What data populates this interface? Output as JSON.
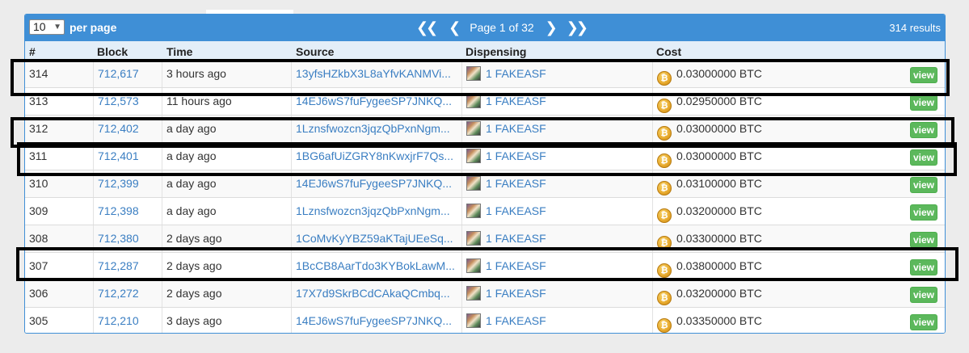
{
  "toolbar": {
    "per_page_value": "10",
    "per_page_label": "per page",
    "first_icon": "double-chevron-left",
    "prev_icon": "chevron-left",
    "page_label": "Page 1 of 32",
    "next_icon": "chevron-right",
    "last_icon": "double-chevron-right",
    "results": "314 results"
  },
  "columns": [
    "#",
    "Block",
    "Time",
    "Source",
    "Dispensing",
    "Cost"
  ],
  "view_label": "view",
  "colors": {
    "header_bar": "#3f8fd6",
    "link": "#3a7ec2",
    "view_button": "#5cb85c",
    "highlight_box": "#000000"
  },
  "rows": [
    {
      "num": "314",
      "block": "712,617",
      "time": "3 hours ago",
      "source": "13yfsHZkbX3L8aYfvKANMVi...",
      "dispensing": "1 FAKEASF",
      "cost": "0.03000000 BTC"
    },
    {
      "num": "313",
      "block": "712,573",
      "time": "11 hours ago",
      "source": "14EJ6wS7fuFygeeSP7JNKQ...",
      "dispensing": "1 FAKEASF",
      "cost": "0.02950000 BTC"
    },
    {
      "num": "312",
      "block": "712,402",
      "time": "a day ago",
      "source": "1Lznsfwozcn3jqzQbPxnNgm...",
      "dispensing": "1 FAKEASF",
      "cost": "0.03000000 BTC"
    },
    {
      "num": "311",
      "block": "712,401",
      "time": "a day ago",
      "source": "1BG6afUiZGRY8nKwxjrF7Qs...",
      "dispensing": "1 FAKEASF",
      "cost": "0.03000000 BTC"
    },
    {
      "num": "310",
      "block": "712,399",
      "time": "a day ago",
      "source": "14EJ6wS7fuFygeeSP7JNKQ...",
      "dispensing": "1 FAKEASF",
      "cost": "0.03100000 BTC"
    },
    {
      "num": "309",
      "block": "712,398",
      "time": "a day ago",
      "source": "1Lznsfwozcn3jqzQbPxnNgm...",
      "dispensing": "1 FAKEASF",
      "cost": "0.03200000 BTC"
    },
    {
      "num": "308",
      "block": "712,380",
      "time": "2 days ago",
      "source": "1CoMvKyYBZ59aKTajUEeSq...",
      "dispensing": "1 FAKEASF",
      "cost": "0.03300000 BTC"
    },
    {
      "num": "307",
      "block": "712,287",
      "time": "2 days ago",
      "source": "1BcCB8AarTdo3KYBokLawM...",
      "dispensing": "1 FAKEASF",
      "cost": "0.03800000 BTC"
    },
    {
      "num": "306",
      "block": "712,272",
      "time": "2 days ago",
      "source": "17X7d9SkrBCdCAkaQCmbq...",
      "dispensing": "1 FAKEASF",
      "cost": "0.03200000 BTC"
    },
    {
      "num": "305",
      "block": "712,210",
      "time": "3 days ago",
      "source": "14EJ6wS7fuFygeeSP7JNKQ...",
      "dispensing": "1 FAKEASF",
      "cost": "0.03350000 BTC"
    }
  ]
}
